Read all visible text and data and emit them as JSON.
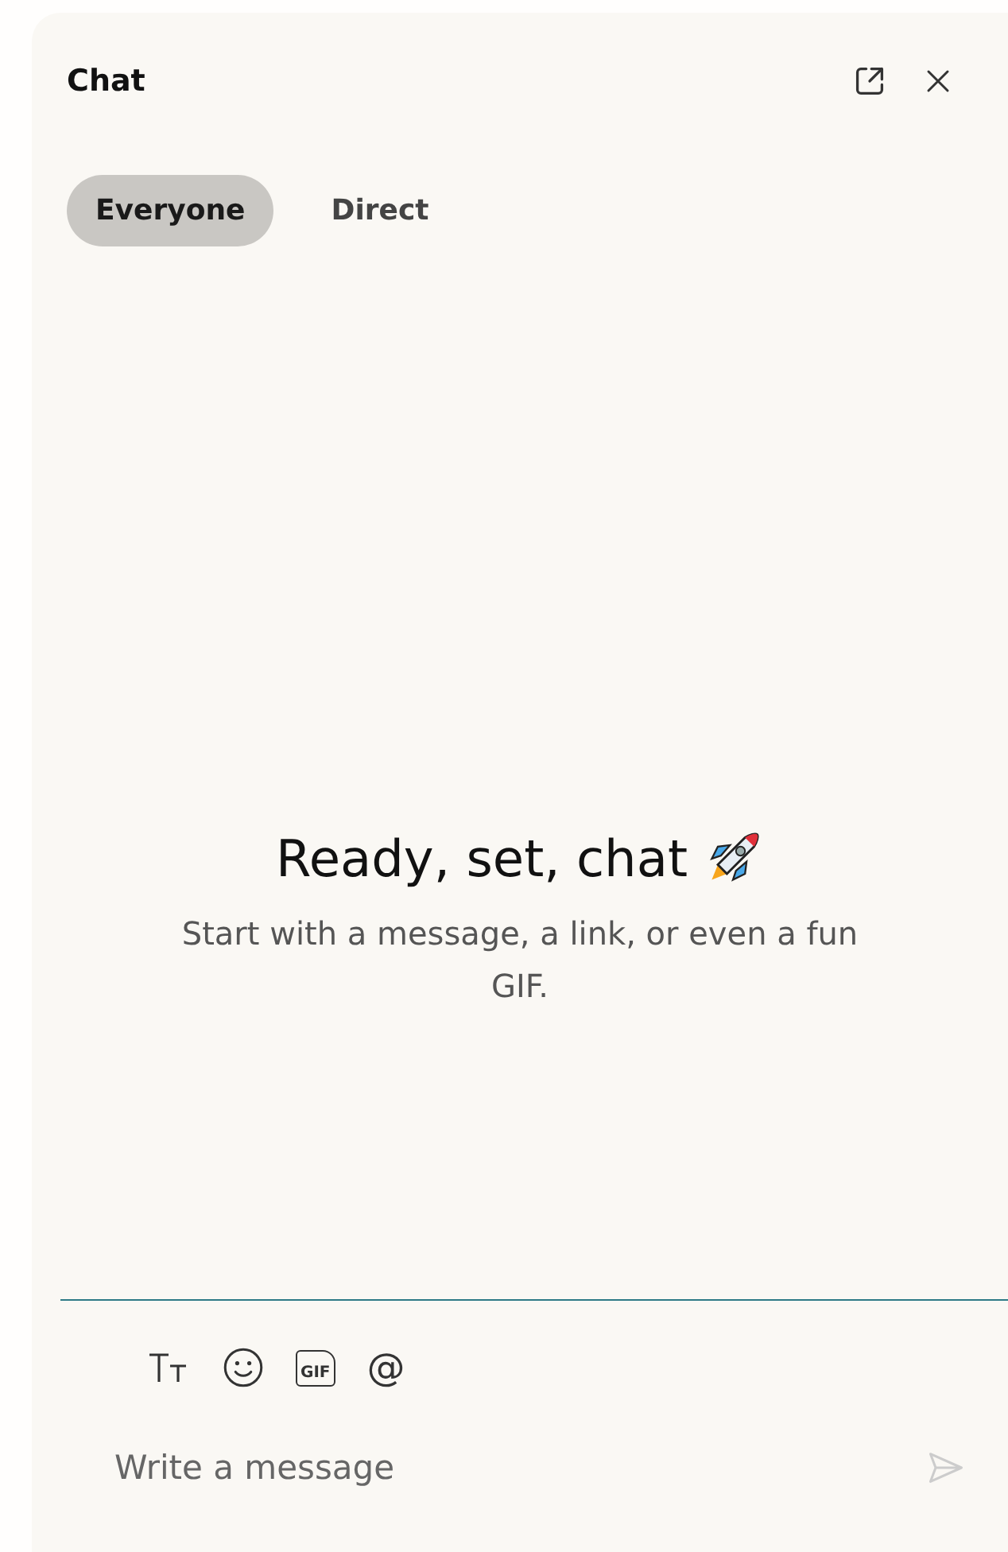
{
  "panel": {
    "title": "Chat"
  },
  "tabs": [
    {
      "label": "Everyone",
      "selected": true
    },
    {
      "label": "Direct",
      "selected": false
    }
  ],
  "empty_state": {
    "heading": "Ready, set, chat",
    "text": "Start with a message, a link, or even a fun GIF."
  },
  "toolbar": [
    {
      "kind": "format"
    },
    {
      "kind": "emoji"
    },
    {
      "kind": "gif",
      "label": "GIF"
    },
    {
      "kind": "mention",
      "label": "@"
    }
  ],
  "composer": {
    "placeholder": "Write a message"
  }
}
